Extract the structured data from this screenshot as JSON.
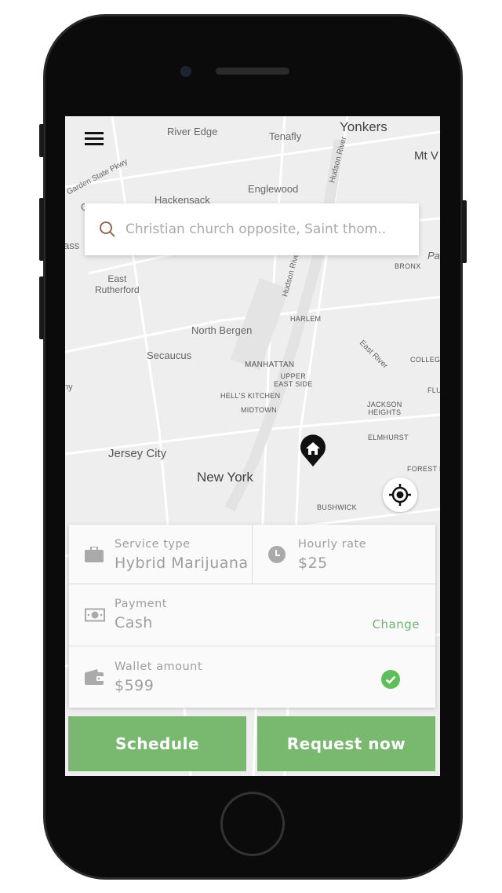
{
  "map": {
    "labels": [
      "River Edge",
      "Tenafly",
      "Yonkers",
      "Mt V",
      "Englewood",
      "Hackensack",
      "Garden State Pkwy",
      "East\nRutherford",
      "North Bergen",
      "HARLEM",
      "BRONX",
      "Hudson River",
      "Hudson River",
      "East River",
      "COLLEGE",
      "Secaucus",
      "MANHATTAN",
      "UPPER\nEAST SIDE",
      "HELL'S KITCHEN",
      "MIDTOWN",
      "JACKSON\nHEIGHTS",
      "ELMHURST",
      "Jersey City",
      "New York",
      "FOREST H",
      "BUSHWICK",
      "FLU",
      "Pa",
      "ass",
      "ny",
      "G"
    ]
  },
  "search": {
    "placeholder": "Christian church opposite, Saint thom.."
  },
  "details": {
    "service_type_label": "Service type",
    "service_type_value": "Hybrid Marijuana",
    "hourly_rate_label": "Hourly rate",
    "hourly_rate_value": "$25",
    "payment_label": "Payment",
    "payment_value": "Cash",
    "change_label": "Change",
    "wallet_label": "Wallet amount",
    "wallet_value": "$599"
  },
  "actions": {
    "schedule": "Schedule",
    "request_now": "Request now"
  },
  "colors": {
    "accent": "#78b96f",
    "link": "#6cb46a"
  }
}
